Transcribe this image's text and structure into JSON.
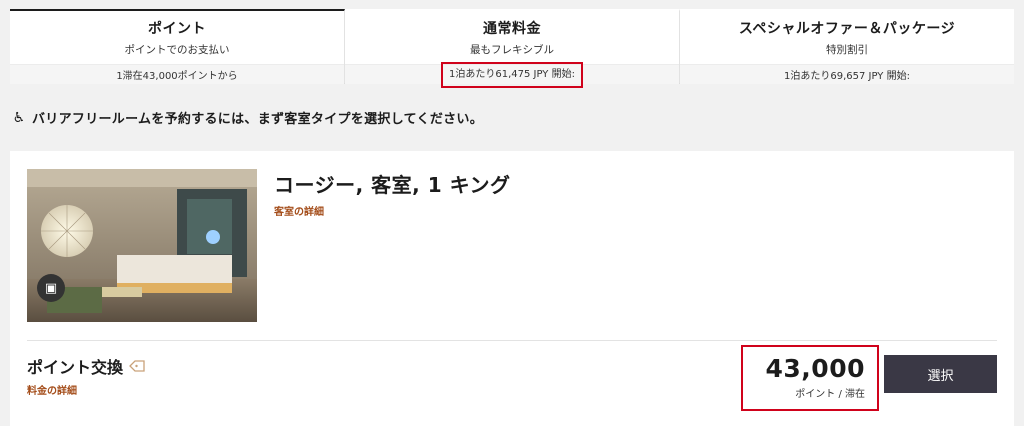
{
  "rate_tabs": [
    {
      "title": "ポイント",
      "subtitle": "ポイントでのお支払い",
      "price": "1滞在43,000ポイントから",
      "active": true,
      "highlighted": false
    },
    {
      "title": "通常料金",
      "subtitle": "最もフレキシブル",
      "price": "1泊あたり61,475 JPY 開始:",
      "active": false,
      "highlighted": true
    },
    {
      "title": "スペシャルオファー＆パッケージ",
      "subtitle": "特別割引",
      "price": "1泊あたり69,657 JPY 開始:",
      "active": false,
      "highlighted": false
    }
  ],
  "notice": {
    "icon": "wheelchair-icon",
    "text": "バリアフリールームを予約するには、まず客室タイプを選択してください。"
  },
  "room": {
    "name": "コージー, 客室, 1 キング",
    "details_link": "客室の詳細",
    "photo_icon": "photo-gallery-icon"
  },
  "rate": {
    "name": "ポイント交換",
    "tag_icon": "tag-icon",
    "details_link": "料金の詳細",
    "points": "43,000",
    "points_unit": "ポイント / 滞在",
    "select_label": "選択"
  },
  "colors": {
    "accent_link": "#a44d1a",
    "button": "#3a3845",
    "highlight": "#d0021b"
  }
}
